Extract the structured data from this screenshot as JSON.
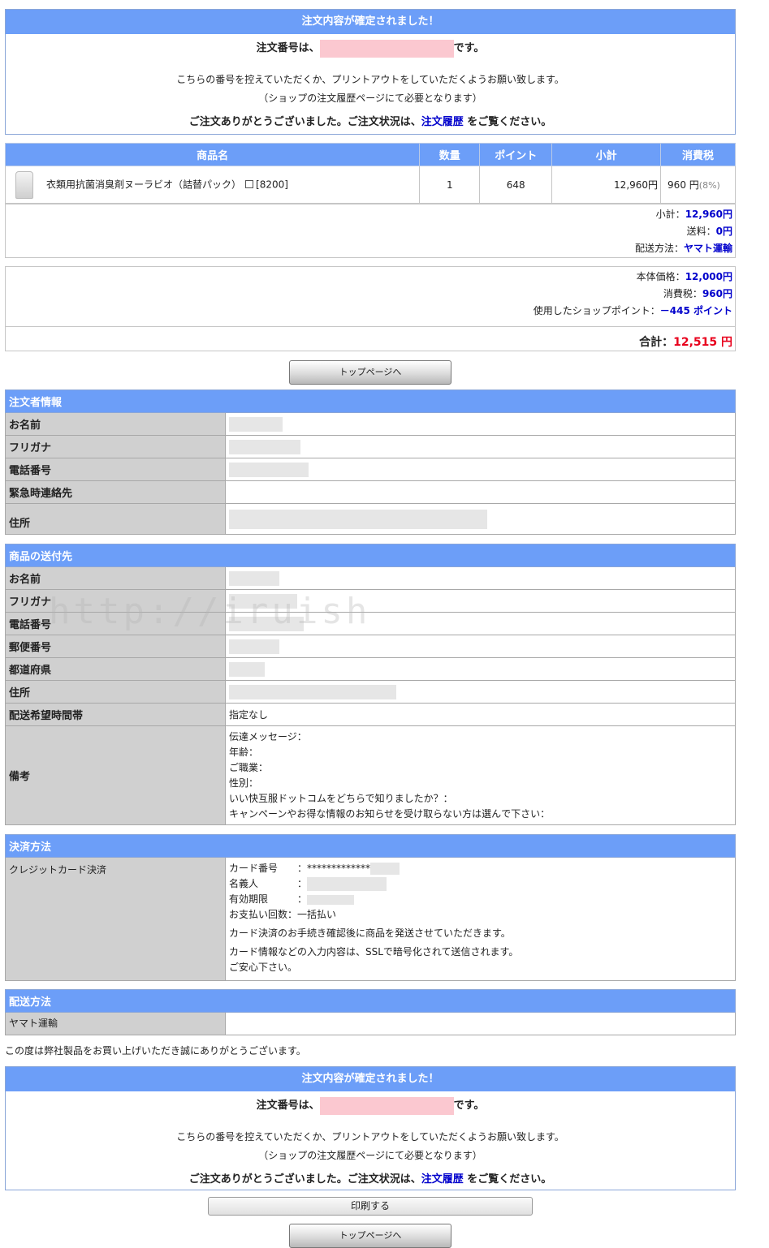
{
  "confirm": {
    "heading": "注文内容が確定されました！",
    "order_prefix": "注文番号は、",
    "order_suffix": "です。",
    "line1": "こちらの番号を控えていただくか、プリントアウトをしていただくようお願い致します。",
    "line2": "（ショップの注文履歴ページにて必要となります）",
    "line3_prefix": "ご注文ありがとうございました。ご注文状況は、",
    "line3_link": "注文履歴",
    "line3_suffix": " をご覧ください。"
  },
  "products": {
    "headers": [
      "商品名",
      "数量",
      "ポイント",
      "小計",
      "消費税"
    ],
    "row": {
      "name": "衣類用抗菌消臭剤ヌーラビオ（詰替パック）",
      "code": "[8200]",
      "qty": "1",
      "points": "648",
      "subtotal": "12,960円",
      "tax": "960 円",
      "tax_rate": "(8%)"
    },
    "summary": [
      {
        "label": "小計：",
        "value": "12,960円"
      },
      {
        "label": "送料：",
        "value": "0円"
      },
      {
        "label": "配送方法：",
        "value": "ヤマト運輸"
      }
    ]
  },
  "totals": {
    "rows": [
      {
        "label": "本体価格：",
        "value": "12,000円"
      },
      {
        "label": "消費税：",
        "value": "960円"
      },
      {
        "label": "使用したショップポイント：",
        "value": "－445 ポイント"
      }
    ],
    "total_label": "合計：",
    "total_value": "12,515 円"
  },
  "buttons": {
    "top_page": "トップページへ",
    "print": "印刷する"
  },
  "orderer": {
    "heading": "注文者情報",
    "rows": [
      "お名前",
      "フリガナ",
      "電話番号",
      "緊急時連絡先",
      "住所"
    ]
  },
  "shipping_dest": {
    "heading": "商品の送付先",
    "rows": [
      "お名前",
      "フリガナ",
      "電話番号",
      "郵便番号",
      "都道府県",
      "住所",
      "配送希望時間帯",
      "備考"
    ],
    "time_value": "指定なし",
    "notes": [
      "伝達メッセージ：",
      "年齢：",
      "ご職業：",
      "性別：",
      "いい快互服ドットコムをどちらで知りましたか？：",
      "キャンペーンやお得な情報のお知らせを受け取らない方は選んで下さい："
    ]
  },
  "payment": {
    "heading": "決済方法",
    "method": "クレジットカード決済",
    "card_label": "カード番号",
    "card_value": "：*************",
    "holder_label": "名義人",
    "holder_value": "：",
    "expiry_label": "有効期限",
    "expiry_value": "：",
    "installments_label": "お支払い回数",
    "installments_value": "：一括払い",
    "note1": "カード決済のお手続き確認後に商品を発送させていただきます。",
    "note2": "カード情報などの入力内容は、SSLで暗号化されて送信されます。",
    "note3": "ご安心下さい。"
  },
  "delivery": {
    "heading": "配送方法",
    "method": "ヤマト運輸"
  },
  "thanks": "この度は弊社製品をお買い上げいただき誠にありがとうございます。",
  "watermark": "http://iruish"
}
